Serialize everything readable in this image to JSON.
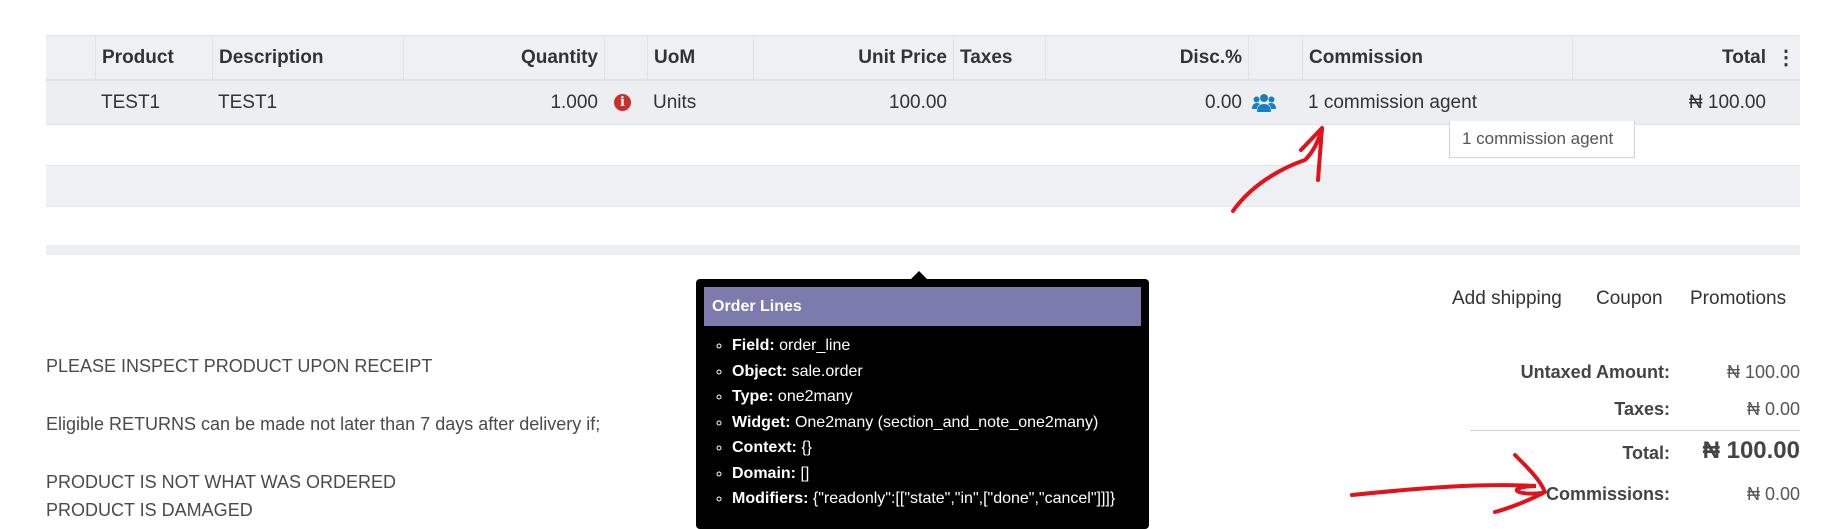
{
  "table": {
    "headers": {
      "product": "Product",
      "description": "Description",
      "quantity": "Quantity",
      "uom": "UoM",
      "unit_price": "Unit Price",
      "taxes": "Taxes",
      "disc": "Disc.%",
      "commission": "Commission",
      "total": "Total"
    },
    "row": {
      "product": "TEST1",
      "description": "TEST1",
      "quantity": "1.000",
      "uom": "Units",
      "unit_price": "100.00",
      "taxes": "",
      "disc": "0.00",
      "commission": "1 commission agent",
      "total": "₦ 100.00"
    },
    "commission_tooltip": "1 commission agent"
  },
  "debug_tooltip": {
    "title": "Order Lines",
    "items": [
      {
        "key": "Field:",
        "value": " order_line"
      },
      {
        "key": "Object:",
        "value": " sale.order"
      },
      {
        "key": "Type:",
        "value": " one2many"
      },
      {
        "key": "Widget:",
        "value": " One2many (section_and_note_one2many)"
      },
      {
        "key": "Context:",
        "value": " {}"
      },
      {
        "key": "Domain:",
        "value": " []"
      },
      {
        "key": "Modifiers:",
        "value": " {\"readonly\":[[\"state\",\"in\",[\"done\",\"cancel\"]]]}"
      }
    ]
  },
  "note": {
    "line1": "PLEASE INSPECT PRODUCT UPON RECEIPT",
    "line2": "Eligible RETURNS can be made not later than 7 days after delivery if;",
    "line3": "PRODUCT IS NOT WHAT WAS ORDERED",
    "line4": "PRODUCT IS DAMAGED"
  },
  "actions": {
    "add_shipping": "Add shipping",
    "coupon": "Coupon",
    "promotions": "Promotions"
  },
  "totals": {
    "untaxed_label": "Untaxed Amount:",
    "untaxed_value": "₦ 100.00",
    "taxes_label": "Taxes:",
    "taxes_value": "₦ 0.00",
    "total_label": "Total:",
    "total_value": "₦ 100.00",
    "commissions_label": "Commissions:",
    "commissions_value": "₦ 0.00"
  },
  "icons": {
    "info": "info-circle-icon",
    "agents": "users-icon",
    "menu": "kebab-menu-icon"
  },
  "colors": {
    "debug_header": "#7c7bad",
    "info_icon": "#c9302c",
    "agents_icon": "#1a7fc1",
    "annotation": "#e0121b"
  }
}
